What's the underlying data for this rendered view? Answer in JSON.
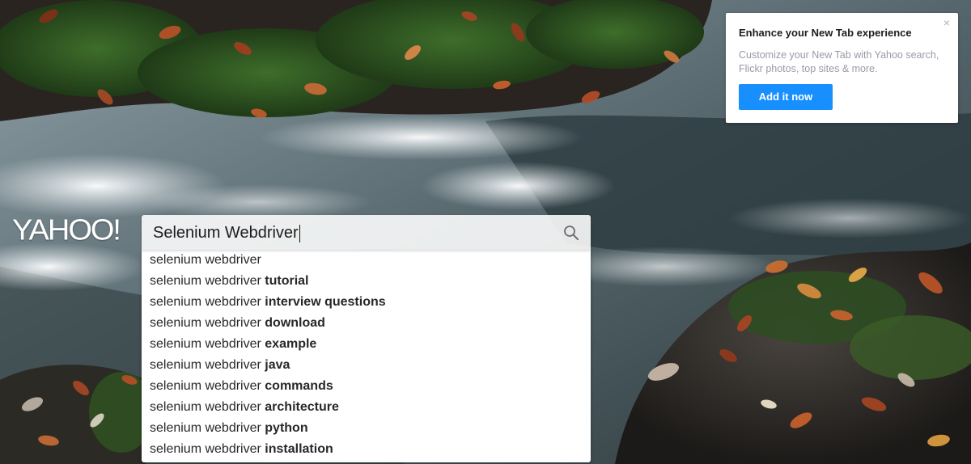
{
  "logo": {
    "text": "YAHOO!"
  },
  "search": {
    "value": "Selenium Webdriver",
    "icon": "search-icon"
  },
  "suggestions": [
    {
      "prefix": "selenium webdriver",
      "suffix": ""
    },
    {
      "prefix": "selenium webdriver ",
      "suffix": "tutorial"
    },
    {
      "prefix": "selenium webdriver ",
      "suffix": "interview questions"
    },
    {
      "prefix": "selenium webdriver ",
      "suffix": "download"
    },
    {
      "prefix": "selenium webdriver ",
      "suffix": "example"
    },
    {
      "prefix": "selenium webdriver ",
      "suffix": "java"
    },
    {
      "prefix": "selenium webdriver ",
      "suffix": "commands"
    },
    {
      "prefix": "selenium webdriver ",
      "suffix": "architecture"
    },
    {
      "prefix": "selenium webdriver ",
      "suffix": "python"
    },
    {
      "prefix": "selenium webdriver ",
      "suffix": "installation"
    }
  ],
  "promo": {
    "title": "Enhance your New Tab experience",
    "text": "Customize your New Tab with Yahoo search, Flickr photos, top sites & more.",
    "button_label": "Add it now",
    "close_label": "×"
  },
  "colors": {
    "accent": "#188fff",
    "suggestion_text": "#26282a",
    "promo_text": "#979ba7"
  }
}
